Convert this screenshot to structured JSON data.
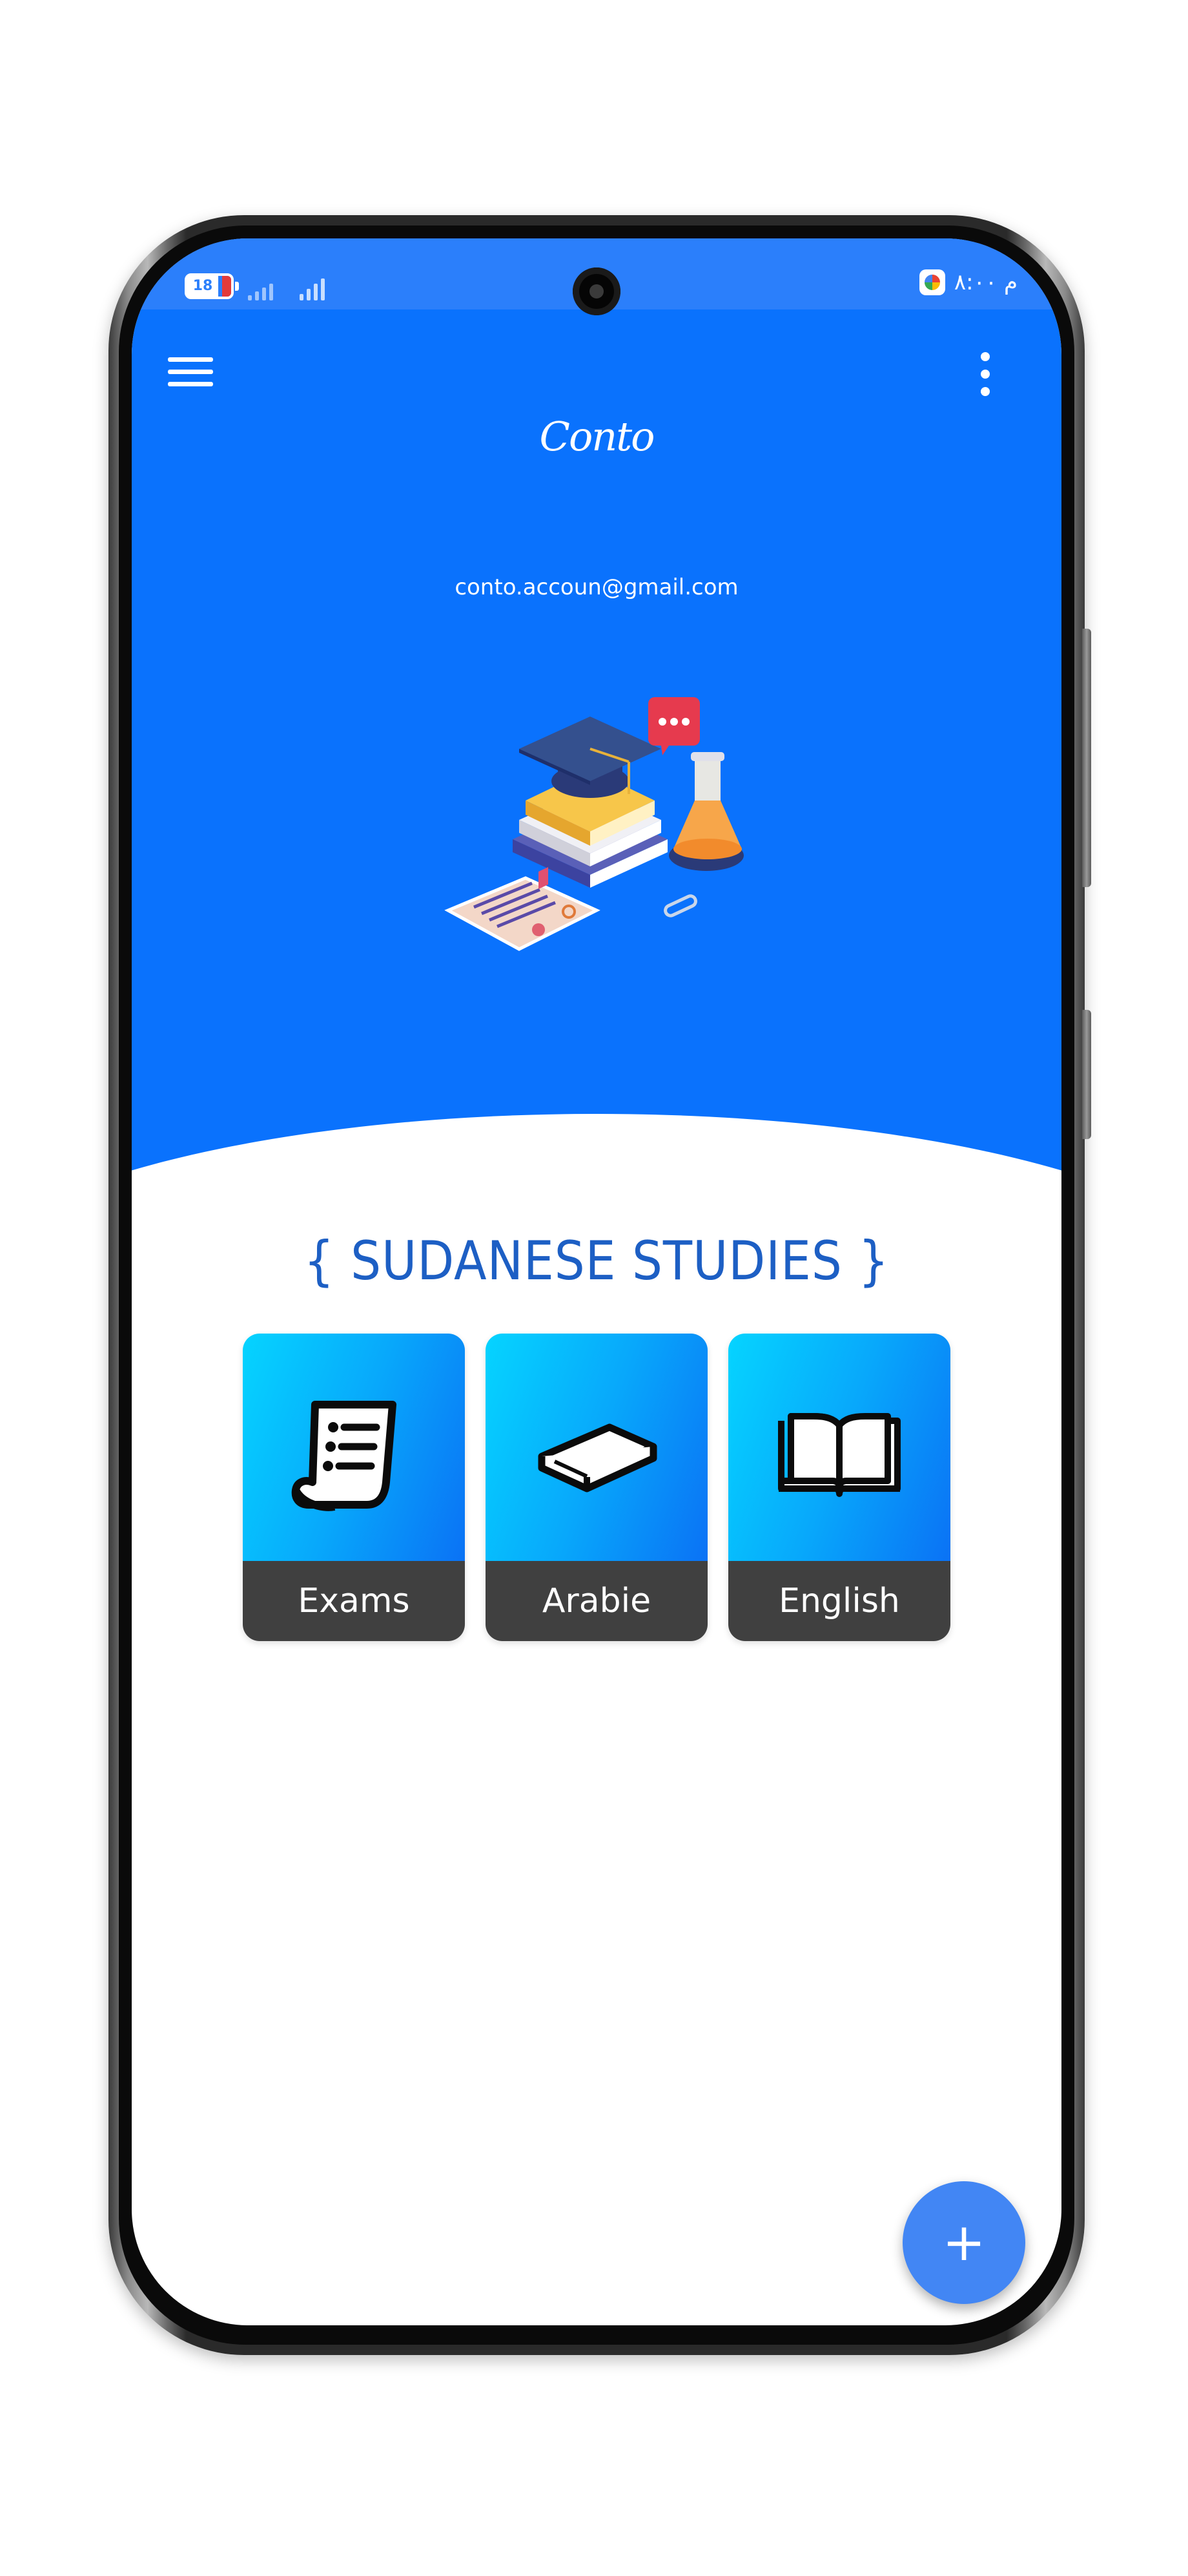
{
  "status_bar": {
    "battery_level": "18",
    "time": "م ٨:٠٠"
  },
  "app": {
    "logo_text": "Conto",
    "account_email": "conto.accoun@gmail.com"
  },
  "section": {
    "title": "{ SUDANESE STUDIES }"
  },
  "cards": [
    {
      "label": "Exams",
      "icon": "exam-sheet-icon"
    },
    {
      "label": "Arabie",
      "icon": "book-icon"
    },
    {
      "label": "English",
      "icon": "open-book-icon"
    }
  ],
  "fab": {
    "label": "+"
  },
  "colors": {
    "header_blue": "#0a72fd",
    "title_blue": "#1d5fc4",
    "card_label_bg": "#404040",
    "fab_blue": "#4286f4"
  }
}
